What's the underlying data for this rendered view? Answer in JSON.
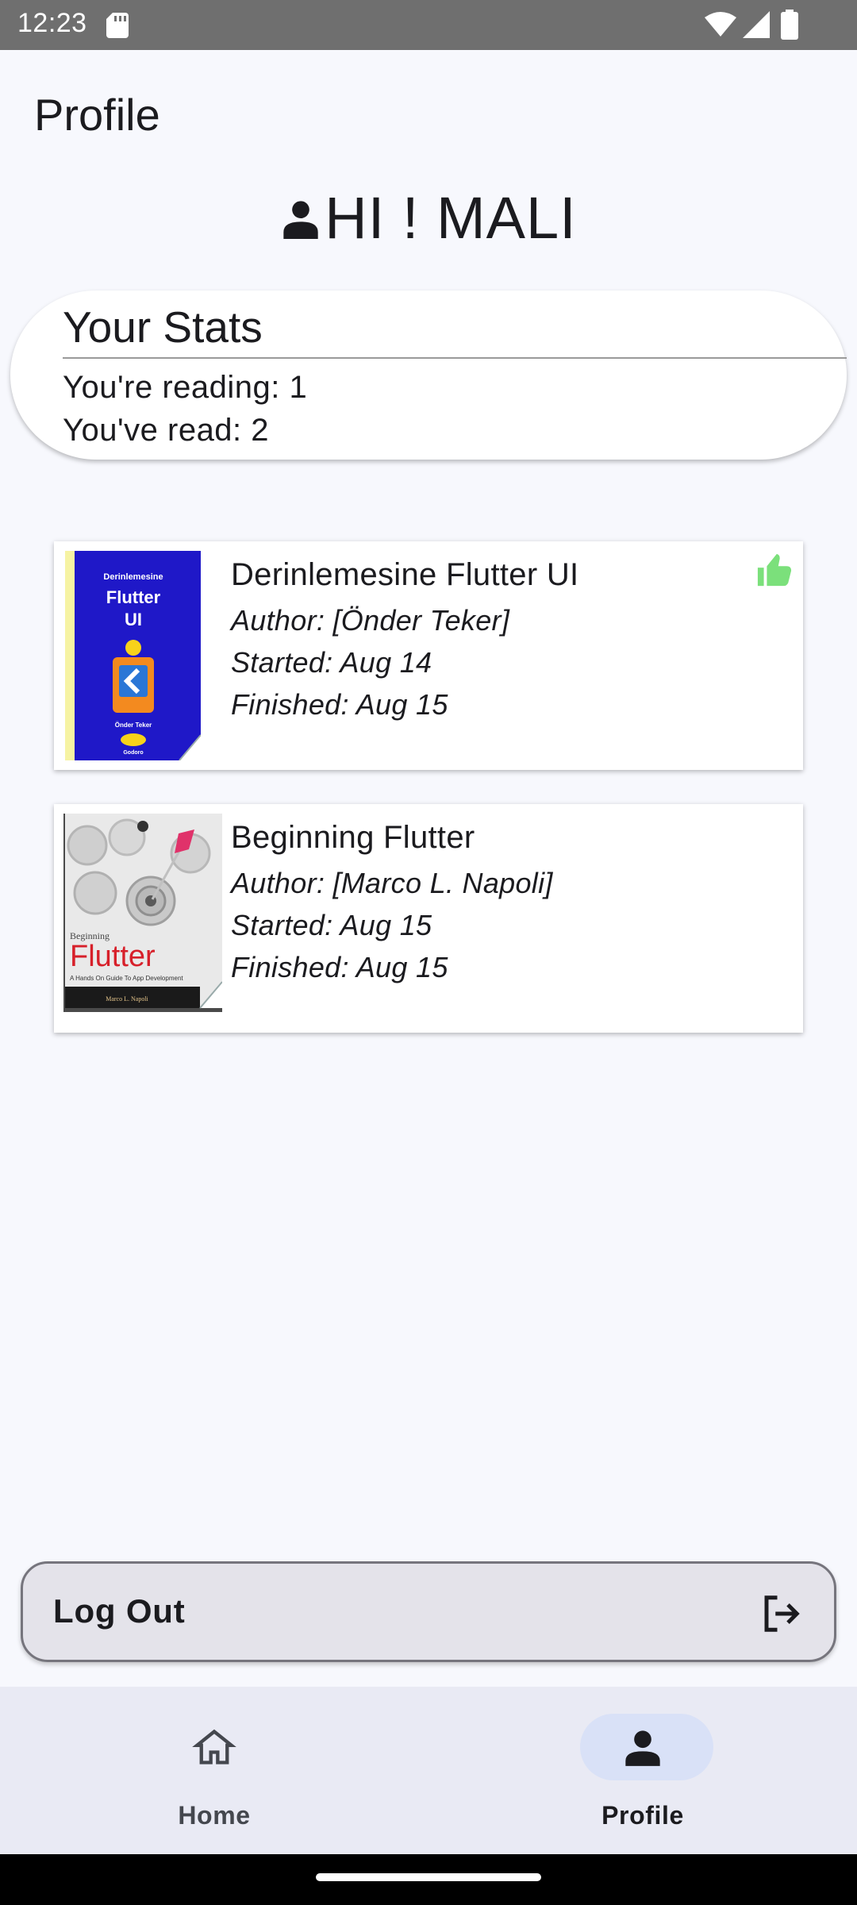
{
  "status_bar": {
    "time": "12:23",
    "icons": [
      "sd-card-icon",
      "wifi-icon",
      "signal-icon",
      "battery-icon"
    ]
  },
  "app_bar": {
    "title": "Profile"
  },
  "greeting": {
    "icon": "person-icon",
    "text": "HI ! MALI"
  },
  "stats": {
    "title": "Your Stats",
    "reading": "You're reading: 1",
    "read": "You've read: 2"
  },
  "books": [
    {
      "title": "Derinlemesine Flutter UI",
      "author": "Author: [Önder Teker]",
      "started": "Started: Aug 14",
      "finished": "Finished: Aug 15",
      "liked": true,
      "cover": {
        "top_text": "Derinlemesine",
        "title_line1": "Flutter",
        "title_line2": "UI",
        "author": "Önder Teker",
        "publisher": "Godoro"
      }
    },
    {
      "title": "Beginning Flutter",
      "author": "Author: [Marco L. Napoli]",
      "started": "Started: Aug 15",
      "finished": "Finished: Aug 15",
      "liked": false,
      "cover": {
        "top_text": "Beginning",
        "title_line1": "Flutter",
        "subtitle": "A Hands On Guide To App Development",
        "author": "Marco L. Napoli"
      }
    }
  ],
  "logout": {
    "label": "Log Out",
    "icon": "logout-icon"
  },
  "bottom_nav": {
    "items": [
      {
        "label": "Home",
        "icon": "home-icon",
        "selected": false
      },
      {
        "label": "Profile",
        "icon": "person-icon",
        "selected": true
      }
    ]
  },
  "colors": {
    "background": "#f7f8fd",
    "liked_icon": "#7be07b",
    "nav_bar": "#e9eaf4",
    "nav_selected_pill": "#d9e1f7",
    "logout_button": "#e4e3ea"
  }
}
